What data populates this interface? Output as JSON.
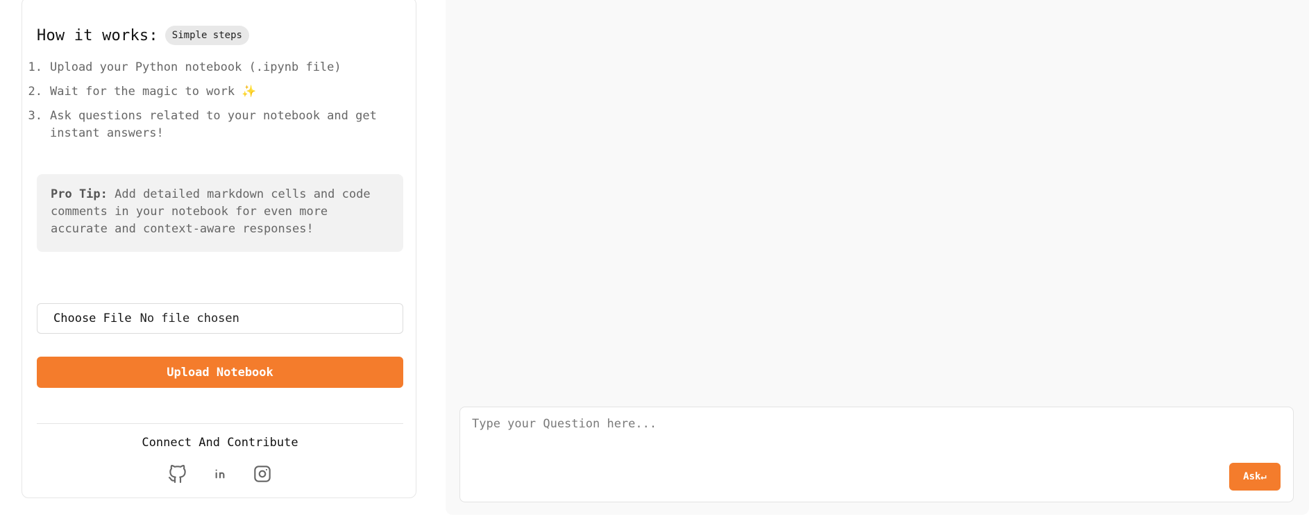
{
  "sidebar": {
    "heading": "How it works:",
    "badge": "Simple steps",
    "steps": [
      {
        "num": "1.",
        "text": "Upload your Python notebook (.ipynb file)"
      },
      {
        "num": "2.",
        "text": "Wait for the magic to work ✨"
      },
      {
        "num": "3.",
        "text": "Ask questions related to your notebook and get instant answers!"
      }
    ],
    "tip_label": "Pro Tip:",
    "tip_text": " Add detailed markdown cells and code comments in your notebook for even more accurate and context-aware responses!",
    "file_input": {
      "button_label": "Choose File",
      "status": "No file chosen"
    },
    "upload_button": "Upload Notebook",
    "connect_title": "Connect And Contribute",
    "social_icons": [
      "github-icon",
      "linkedin-icon",
      "instagram-icon"
    ]
  },
  "chat": {
    "placeholder": "Type your Question here...",
    "ask_button": "Ask↵"
  },
  "colors": {
    "accent": "#f47c2c",
    "tip_background": "#f2f2f2",
    "chat_background": "#f9f9f9"
  }
}
